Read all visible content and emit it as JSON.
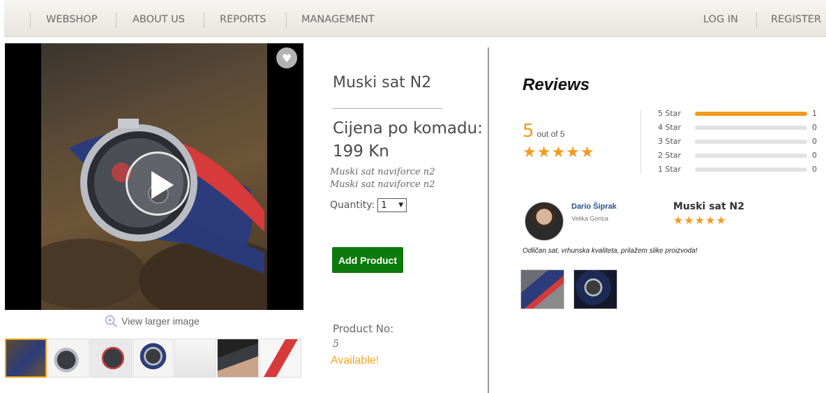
{
  "nav": {
    "webshop": "WEBSHOP",
    "about": "ABOUT US",
    "reports": "REPORTS",
    "management": "MANAGEMENT",
    "login": "LOG IN",
    "register": "REGISTER"
  },
  "gallery": {
    "view_larger": "View larger image",
    "thumbnail_count": 7
  },
  "product": {
    "title": "Muski sat N2",
    "price_line1": "Cijena po komadu:",
    "price_line2": "199 Kn",
    "description_line1": "Muski sat naviforce n2",
    "description_line2": "Muski sat naviforce n2",
    "quantity_label": "Quantity:",
    "quantity_value": "1",
    "add_button": "Add Product",
    "product_no_label": "Product No:",
    "product_no_value": "5",
    "availability": "Available!",
    "availability_color": "#f3a722",
    "add_button_color": "#0c7a0c"
  },
  "reviews": {
    "title": "Reviews",
    "average": "5",
    "out_of": "out of 5",
    "average_stars": 5,
    "accent_color": "#f39a1f",
    "distribution": [
      {
        "label": "5 Star",
        "count": "1",
        "fraction": 1
      },
      {
        "label": "4 Star",
        "count": "0",
        "fraction": 0
      },
      {
        "label": "3 Star",
        "count": "0",
        "fraction": 0
      },
      {
        "label": "2 Star",
        "count": "0",
        "fraction": 0
      },
      {
        "label": "1 Star",
        "count": "0",
        "fraction": 0
      }
    ],
    "items": [
      {
        "reviewer": "Dario Šiprak",
        "location": "Velika Gorica",
        "product": "Muski sat N2",
        "stars": 5,
        "text": "Odličan sat, vrhunska kvaliteta, prilažem slike proizvoda!",
        "image_count": 2
      }
    ]
  }
}
